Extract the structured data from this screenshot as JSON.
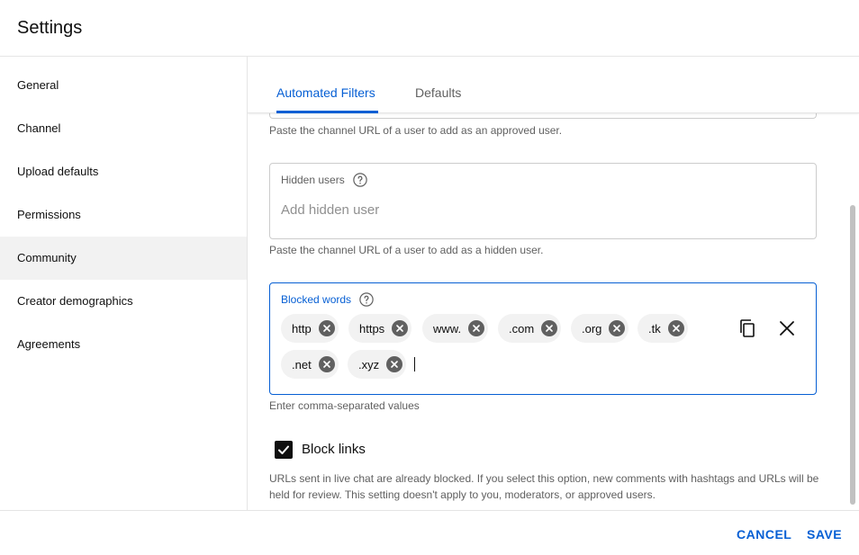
{
  "dialog": {
    "title": "Settings"
  },
  "sidebar": {
    "items": [
      {
        "label": "General"
      },
      {
        "label": "Channel"
      },
      {
        "label": "Upload defaults"
      },
      {
        "label": "Permissions"
      },
      {
        "label": "Community",
        "active": true
      },
      {
        "label": "Creator demographics"
      },
      {
        "label": "Agreements"
      }
    ]
  },
  "tabs": [
    {
      "label": "Automated Filters",
      "active": true
    },
    {
      "label": "Defaults"
    }
  ],
  "approved_users": {
    "helper": "Paste the channel URL of a user to add as an approved user."
  },
  "hidden_users": {
    "label": "Hidden users",
    "placeholder": "Add hidden user",
    "helper": "Paste the channel URL of a user to add as a hidden user."
  },
  "blocked_words": {
    "label": "Blocked words",
    "chips": [
      "http",
      "https",
      "www.",
      ".com",
      ".org",
      ".tk",
      ".net",
      ".xyz"
    ],
    "helper": "Enter comma-separated values"
  },
  "block_links": {
    "label": "Block links",
    "checked": true,
    "note": "URLs sent in live chat are already blocked. If you select this option, new comments with hashtags and URLs will be held for review. This setting doesn't apply to you, moderators, or approved users."
  },
  "footer": {
    "cancel": "CANCEL",
    "save": "SAVE"
  },
  "colors": {
    "accent": "#065fd4",
    "active_nav_bg": "#f2f2f2",
    "chip_bg": "#f2f2f2"
  },
  "icons": [
    "help-icon",
    "chip-remove-icon",
    "copy-icon",
    "close-icon",
    "checkmark-icon"
  ]
}
